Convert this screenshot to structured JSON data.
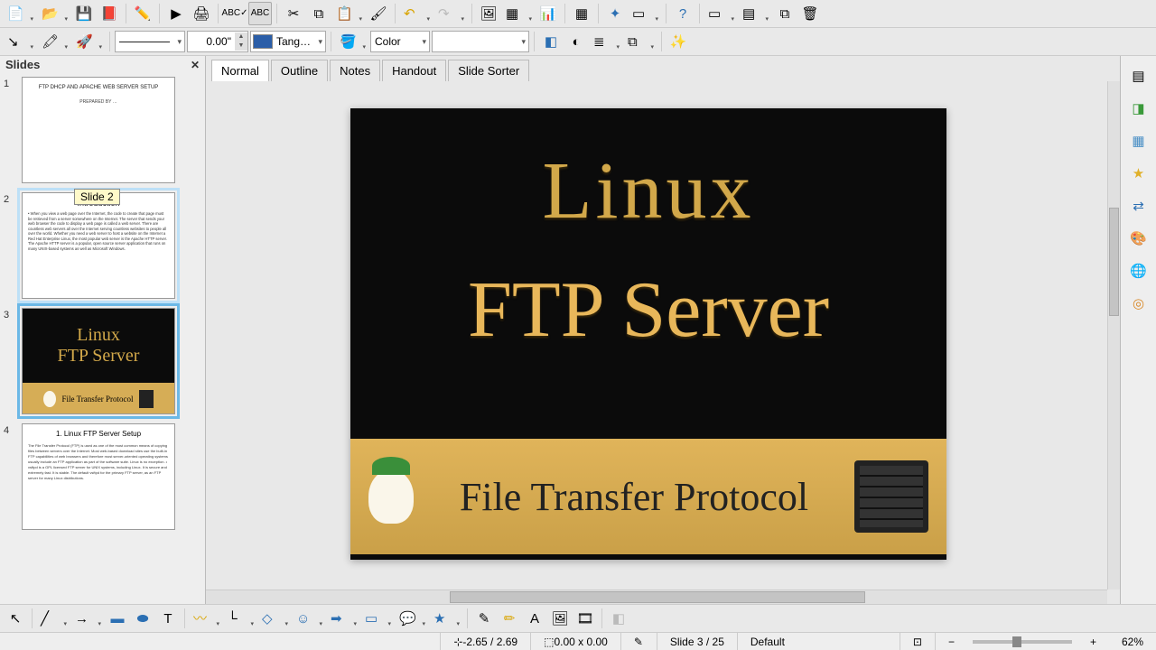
{
  "toolbar1": {
    "new": "new-doc",
    "open": "open",
    "save": "save",
    "savepdf": "export-pdf",
    "edit": "edit",
    "play": "slideshow",
    "print": "print",
    "spell": "spell-check",
    "spellauto": "auto-spell",
    "cut": "cut",
    "copy": "copy",
    "paste": "paste",
    "fmtpaint": "format-paint",
    "undo": "undo",
    "redo": "redo",
    "img": "insert-image",
    "table": "insert-table",
    "chart": "insert-chart",
    "grid": "grid",
    "snap": "snap",
    "insslide": "insert-slide",
    "help": "help",
    "new2": "new-slide",
    "layout": "layout",
    "dup": "duplicate",
    "del": "delete-slide"
  },
  "toolbar2": {
    "line_width": "0.00\"",
    "area_color_label": "Tang…",
    "area_color_hex": "#2b5ea8",
    "fill_label": "Color"
  },
  "panel": {
    "title": "Slides",
    "tooltip": "Slide 2"
  },
  "thumbs": {
    "s1": {
      "n": "1",
      "title": "FTP DHCP AND APACHE WEB SERVER SETUP",
      "sub": "PREPARED BY …"
    },
    "s2": {
      "n": "2",
      "title": "Introduction",
      "body": "• When you view a web page over the Internet, the code to create that page must be retrieved from a server somewhere on the Internet. The server that sends your web browser the code to display a web page is called a web server. There are countless web servers all over the Internet serving countless websites to people all over the world. Whether you need a web server to host a website on the Internet a Red Hat Enterprise Linux, the most popular web server is the Apache HTTP server. The Apache HTTP server is a popular, open source server application that runs on many UNIX-based systems as well as Microsoft Windows."
    },
    "s3": {
      "n": "3",
      "l1": "Linux",
      "l2": "FTP Server",
      "l3": "File Transfer Protocol"
    },
    "s4": {
      "n": "4",
      "title": "1. Linux FTP Server Setup",
      "body": "The File Transfer Protocol (FTP) is used as one of the most common means of copying files between servers over the Internet. Most web-based download sites use the built-in FTP capabilities of web browsers and therefore most server-oriented operating systems usually include an FTP application as part of the software suite. Linux is no exception.\n\n• vsftpd is a GPL licensed FTP server for UNIX systems, including Linux. It is secure and extremely fast. It is stable.\nThe default vsftpd for the primary FTP server, as an FTP server for many Linux distributions."
    }
  },
  "tabs": {
    "normal": "Normal",
    "outline": "Outline",
    "notes": "Notes",
    "handout": "Handout",
    "sorter": "Slide Sorter"
  },
  "slide": {
    "l1": "Linux",
    "l2": "FTP Server",
    "ftp": "File Transfer Protocol"
  },
  "status": {
    "pos": "-2.65 / 2.69",
    "size": "0.00 x 0.00",
    "slide": "Slide 3 / 25",
    "style": "Default",
    "zoom": "62%"
  }
}
